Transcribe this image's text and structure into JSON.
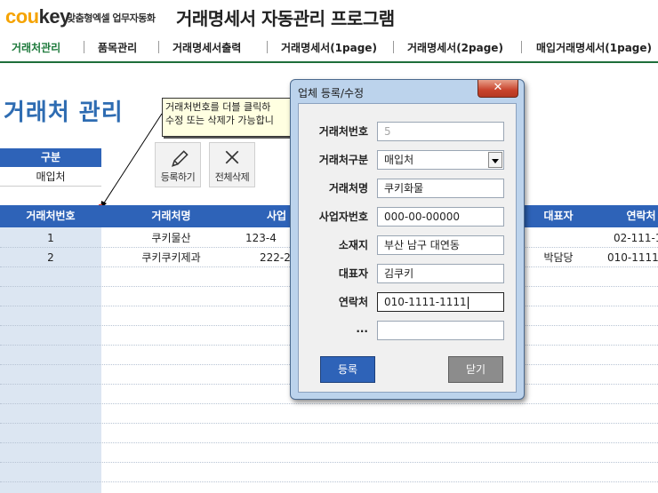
{
  "header": {
    "brand_left": "cou",
    "brand_right": "key",
    "tagline": "맞춤형엑셀 업무자동화",
    "app_title": "거래명세서 자동관리 프로그램"
  },
  "nav": {
    "items": [
      {
        "label": "거래처관리",
        "active": true
      },
      {
        "label": "품목관리",
        "active": false
      },
      {
        "label": "거래명세서출력",
        "active": false
      },
      {
        "label": "거래명세서(1page)",
        "active": false
      },
      {
        "label": "거래명세서(2page)",
        "active": false
      },
      {
        "label": "매입거래명세서(1page)",
        "active": false
      }
    ]
  },
  "page": {
    "title": "거래처 관리",
    "note_lines": [
      "거래처번호를 더블 클릭하",
      "수정 또는 삭제가 가능합니"
    ]
  },
  "category": {
    "header": "구분",
    "value": "매입처"
  },
  "tools": {
    "register": {
      "label": "등록하기",
      "icon": "pencil-icon"
    },
    "delete_all": {
      "label": "전체삭제",
      "icon": "close-icon"
    }
  },
  "table": {
    "columns": [
      "거래처번호",
      "거래처명",
      "사업",
      "대표자",
      "연락처"
    ],
    "rows": [
      {
        "no": "1",
        "name": "쿠키물산",
        "biz": "123-4",
        "ceo": "",
        "phone": "02-111-1"
      },
      {
        "no": "2",
        "name": "쿠키쿠키제과",
        "biz": "222-2",
        "ceo": "박담당",
        "phone": "010-1111-"
      }
    ]
  },
  "dialog": {
    "title": "업체 등록/수정",
    "close_glyph": "✕",
    "fields": [
      {
        "label": "거래처번호",
        "value": "5"
      },
      {
        "label": "거래처구분",
        "value": "매입처"
      },
      {
        "label": "거래처명",
        "value": "쿠키화물"
      },
      {
        "label": "사업자번호",
        "value": "000-00-00000"
      },
      {
        "label": "소재지",
        "value": "부산 남구 대연동"
      },
      {
        "label": "대표자",
        "value": "김쿠키"
      },
      {
        "label": "연락처",
        "value": "010-1111-1111"
      },
      {
        "label": "...",
        "value": ""
      }
    ],
    "register_label": "등록",
    "close_label": "닫기"
  },
  "colors": {
    "accent_blue": "#2e63b8",
    "title_blue": "#2e6cb2",
    "nav_green": "#1e7a3c",
    "brand_orange": "#f5a300",
    "shade": "#dce6f2"
  }
}
